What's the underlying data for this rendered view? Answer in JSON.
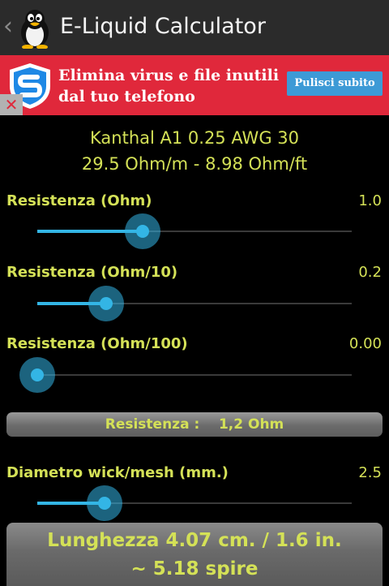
{
  "actionbar": {
    "back_glyph": "‹",
    "title": "E-Liquid Calculator",
    "icon": "penguin-icon"
  },
  "ad": {
    "line1": "Elimina virus e file inutili",
    "line2": "dal tuo telefono",
    "button_label": "Pulisci subito",
    "close_glyph": "✕",
    "icon": "shield-s-icon",
    "color": "#e0283b"
  },
  "wire": {
    "name": "Kanthal A1 0.25 AWG 30",
    "specs": "29.5 Ohm/m  -  8.98 Ohm/ft"
  },
  "sliders": [
    {
      "label": "Resistenza (Ohm)",
      "value": "1.0",
      "position_fraction": 0.335
    },
    {
      "label": "Resistenza (Ohm/10)",
      "value": "0.2",
      "position_fraction": 0.22
    },
    {
      "label": "Resistenza (Ohm/100)",
      "value": "0.00",
      "position_fraction": 0.0
    },
    {
      "label": "Diametro wick/mesh (mm.)",
      "value": "2.5",
      "position_fraction": 0.215
    }
  ],
  "resistance_summary": {
    "label": "Resistenza :",
    "value": "1,2 Ohm"
  },
  "result": {
    "line1": "Lunghezza 4.07 cm. / 1.6 in.",
    "line2": "~ 5.18 spire"
  },
  "colors": {
    "accent": "#33b5e5",
    "text_highlight": "#d4e157",
    "actionbar_bg": "#2b2b2b"
  }
}
